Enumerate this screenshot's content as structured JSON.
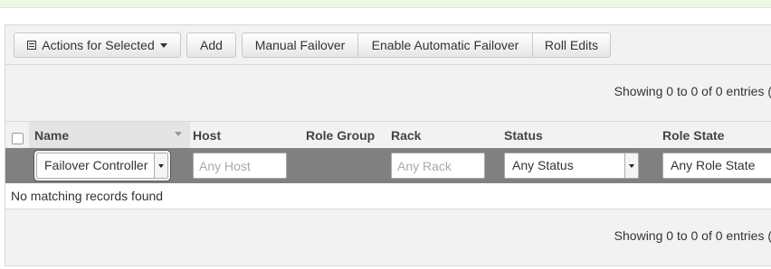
{
  "toolbar": {
    "actions_label": "Actions for Selected",
    "actions_icon": "list-icon",
    "add_label": "Add",
    "manual_failover_label": "Manual Failover",
    "enable_auto_failover_label": "Enable Automatic Failover",
    "roll_edits_label": "Roll Edits"
  },
  "info": {
    "top_text": "Showing 0 to 0 of 0 entries (",
    "bottom_text": "Showing 0 to 0 of 0 entries ("
  },
  "table": {
    "columns": [
      "Name",
      "Host",
      "Role Group",
      "Rack",
      "Status",
      "Role State"
    ],
    "filters": {
      "name_value": "Failover Controller",
      "host_placeholder": "Any Host",
      "rack_placeholder": "Any Rack",
      "status_value": "Any Status",
      "role_state_value": "Any Role State"
    },
    "empty_message": "No matching records found"
  },
  "colors": {
    "alert_bg": "#eef7e6",
    "filter_row_bg": "#808080",
    "panel_bg": "#f2f2f2"
  }
}
